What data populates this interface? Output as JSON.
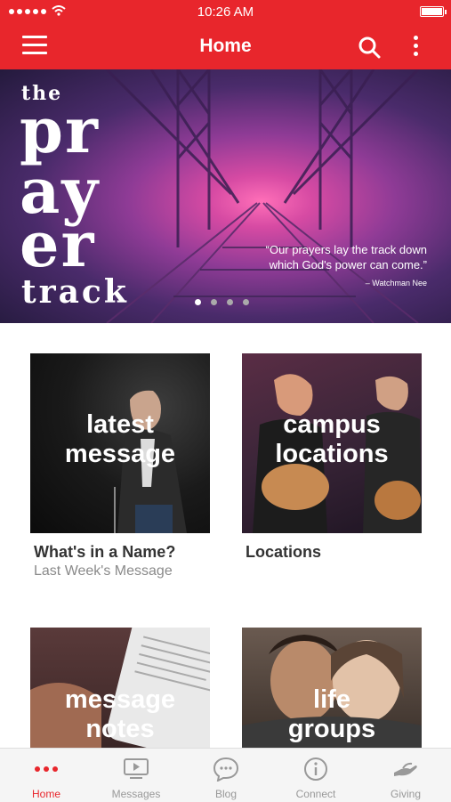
{
  "status_bar": {
    "time": "10:26 AM"
  },
  "header": {
    "title": "Home"
  },
  "hero": {
    "words": [
      "the",
      "pr",
      "ay",
      "er",
      "track"
    ],
    "quote": "“Our prayers lay the track down which God's power can come.”",
    "quote_author": "– Watchman Nee",
    "slides": 4,
    "active_slide": 1
  },
  "cards": [
    {
      "image_text": "latest message",
      "caption": "What's in a Name?",
      "subcaption": "Last Week's Message"
    },
    {
      "image_text": "campus locations",
      "caption": "Locations",
      "subcaption": ""
    },
    {
      "image_text": "message notes",
      "caption": "",
      "subcaption": ""
    },
    {
      "image_text": "life groups",
      "caption": "",
      "subcaption": ""
    }
  ],
  "tabbar": {
    "items": [
      {
        "label": "Home",
        "icon": "dots-icon",
        "active": true
      },
      {
        "label": "Messages",
        "icon": "video-icon",
        "active": false
      },
      {
        "label": "Blog",
        "icon": "chat-bubble-icon",
        "active": false
      },
      {
        "label": "Connect",
        "icon": "info-icon",
        "active": false
      },
      {
        "label": "Giving",
        "icon": "giving-hand-icon",
        "active": false
      }
    ]
  },
  "colors": {
    "brand": "#e8262c",
    "tab_inactive": "#999999"
  }
}
